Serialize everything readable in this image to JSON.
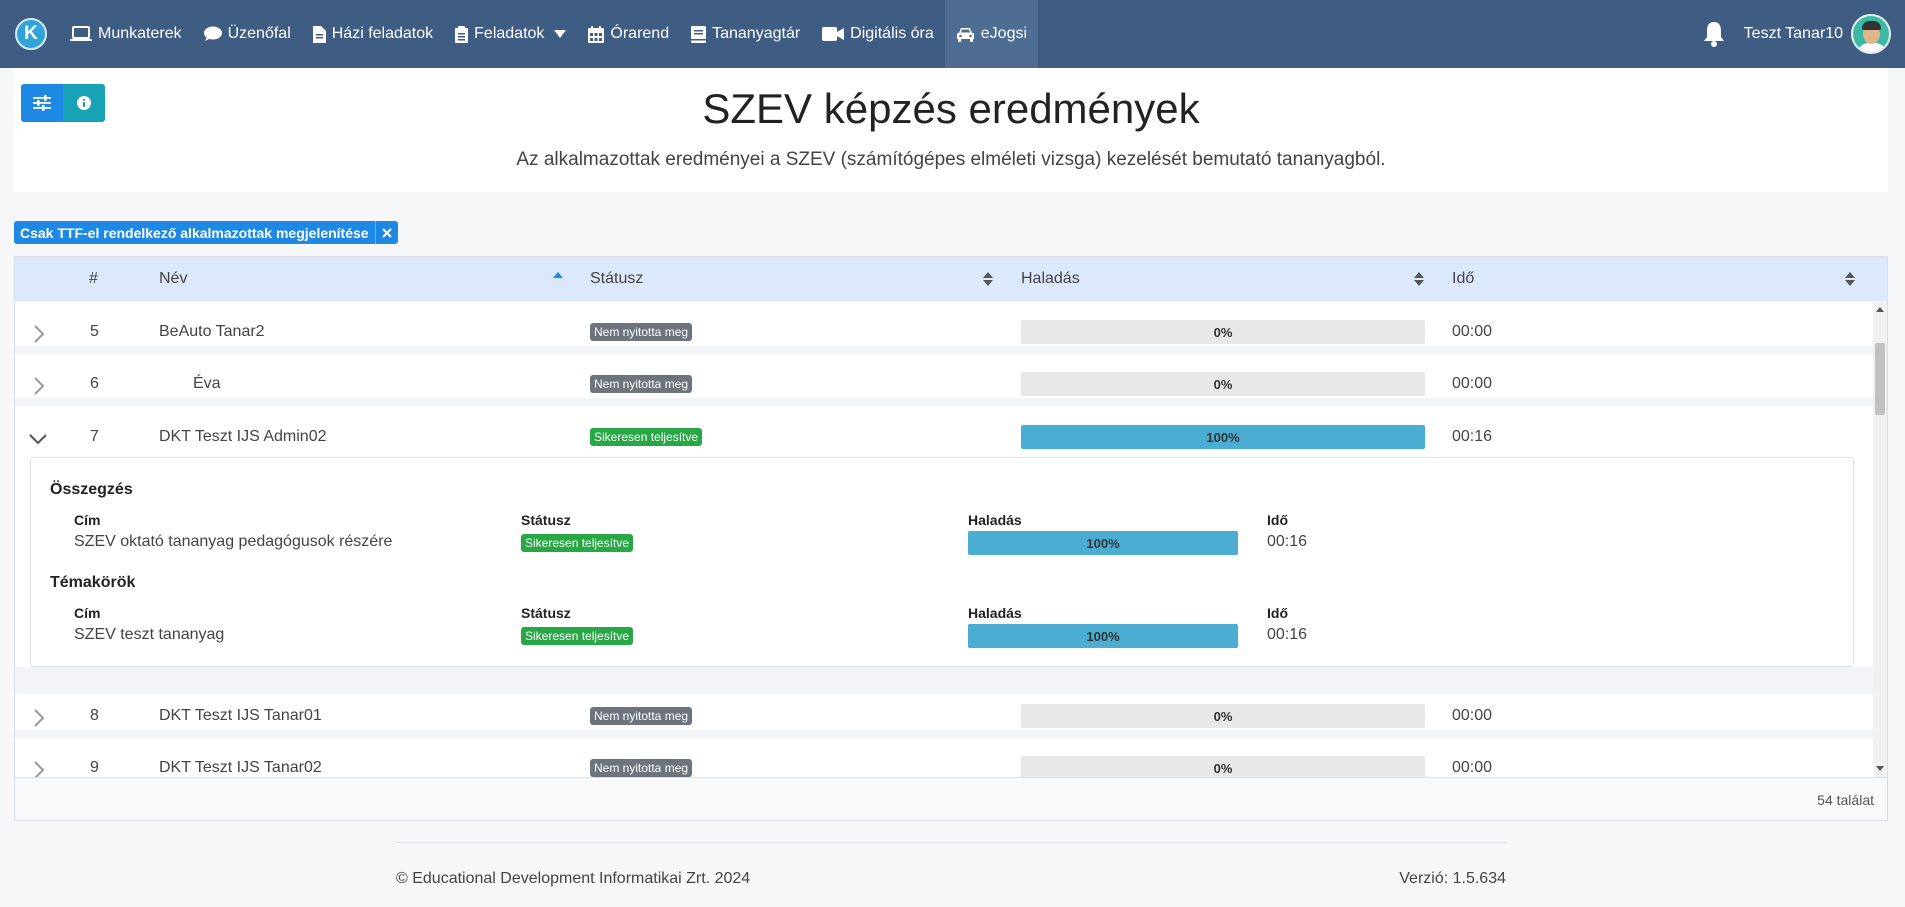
{
  "nav": {
    "brand": "K",
    "items": [
      {
        "label": "Munkaterek"
      },
      {
        "label": "Üzenőfal"
      },
      {
        "label": "Házi feladatok"
      },
      {
        "label": "Feladatok"
      },
      {
        "label": "Órarend"
      },
      {
        "label": "Tananyagtár"
      },
      {
        "label": "Digitális óra"
      },
      {
        "label": "eJogsi"
      }
    ],
    "user_name": "Teszt Tanar10"
  },
  "header": {
    "title": "SZEV képzés eredmények",
    "subtitle": "Az alkalmazottak eredményei a SZEV (számítógépes elméleti vizsga) kezelését bemutató tananyagból."
  },
  "filter": {
    "label": "Csak TTF-el rendelkező alkalmazottak megjelenítése"
  },
  "table": {
    "columns": {
      "num": "#",
      "name": "Név",
      "status": "Státusz",
      "progress": "Haladás",
      "time": "Idő"
    },
    "rows": [
      {
        "num": "5",
        "name": "BeAuto Tanar2",
        "status": "Nem nyitotta meg",
        "progress": 0,
        "progress_label": "0%",
        "time": "00:00"
      },
      {
        "num": "6",
        "name": "Éva",
        "status": "Nem nyitotta meg",
        "progress": 0,
        "progress_label": "0%",
        "time": "00:00"
      },
      {
        "num": "7",
        "name": "DKT Teszt IJS Admin02",
        "status": "Sikeresen teljesítve",
        "progress": 100,
        "progress_label": "100%",
        "time": "00:16"
      },
      {
        "num": "8",
        "name": "DKT Teszt IJS Tanar01",
        "status": "Nem nyitotta meg",
        "progress": 0,
        "progress_label": "0%",
        "time": "00:00"
      },
      {
        "num": "9",
        "name": "DKT Teszt IJS Tanar02",
        "status": "Nem nyitotta meg",
        "progress": 0,
        "progress_label": "0%",
        "time": "00:00"
      }
    ],
    "detail": {
      "summary_title": "Összegzés",
      "topics_title": "Témakörök",
      "col_title": "Cím",
      "col_status": "Státusz",
      "col_progress": "Haladás",
      "col_time": "Idő",
      "summary": {
        "title": "SZEV oktató tananyag pedagógusok részére",
        "status": "Sikeresen teljesítve",
        "progress": 100,
        "progress_label": "100%",
        "time": "00:16"
      },
      "topic": {
        "title": "SZEV teszt tananyag",
        "status": "Sikeresen teljesítve",
        "progress": 100,
        "progress_label": "100%",
        "time": "00:16"
      }
    },
    "result_count": "54 találat"
  },
  "footer": {
    "copyright": "© Educational Development Informatikai Zrt. 2024",
    "version": "Verzió: 1.5.634"
  },
  "colors": {
    "navbar": "#3f5c83",
    "primary": "#1e88e5",
    "progress": "#4aadd1",
    "success": "#28a745",
    "muted": "#6c757d"
  }
}
